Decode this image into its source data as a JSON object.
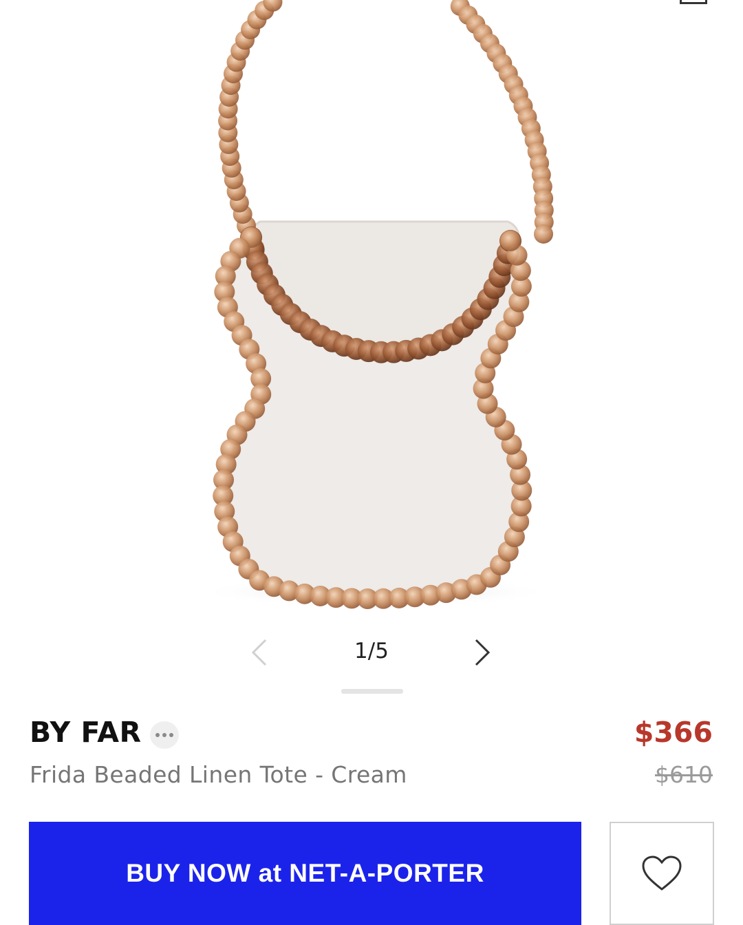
{
  "gallery": {
    "image_alt": "Frida Beaded Linen Tote - Cream",
    "page_indicator": "1/5",
    "current_page": 1,
    "total_pages": 5
  },
  "product": {
    "brand": "BY FAR",
    "name": "Frida Beaded Linen Tote - Cream",
    "sale_price": "$366",
    "original_price": "$610"
  },
  "actions": {
    "buy_label": "BUY NOW at NET-A-PORTER"
  },
  "icons": {
    "more": "more-icon",
    "prev": "chevron-left-icon",
    "next": "chevron-right-icon",
    "wishlist": "heart-icon"
  },
  "colors": {
    "accent": "#1b23ea",
    "sale": "#b8372b",
    "bag_linen": "#eeebe8",
    "beads": "#c48a5d"
  }
}
